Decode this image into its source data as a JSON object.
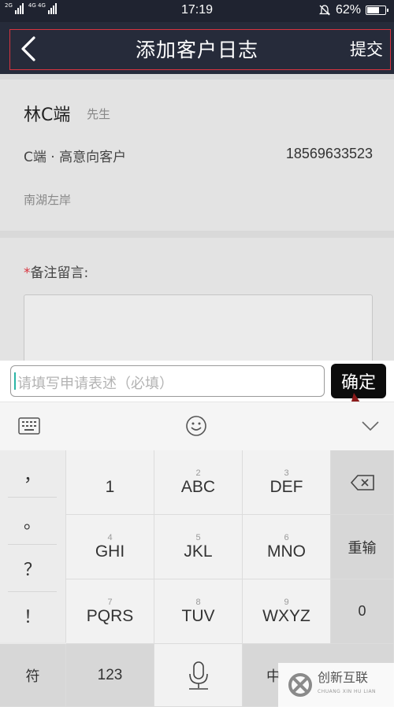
{
  "status_bar": {
    "network_tag_1": "2G",
    "network_tag_2": "4G 4G",
    "time": "17:19",
    "battery": "62%",
    "battery_level": 0.62
  },
  "nav": {
    "title": "添加客户日志",
    "submit": "提交",
    "back_icon": "chevron-left-icon"
  },
  "customer": {
    "name": "林C端",
    "gender": "先生",
    "type": "C端 · 高意向客户",
    "phone": "18569633523",
    "address": "南湖左岸"
  },
  "remark": {
    "required_mark": "*",
    "label": "备注留言:"
  },
  "input_bar": {
    "placeholder": "请填写申请表述（必填）",
    "confirm": "确定"
  },
  "keyboard": {
    "toolbar_icons": [
      "keyboard-icon",
      "emoji-icon",
      "collapse-icon"
    ],
    "punctuation": [
      "，",
      "。",
      "？",
      "！"
    ],
    "rows": [
      [
        {
          "num": "",
          "label": "1"
        },
        {
          "num": "2",
          "label": "ABC"
        },
        {
          "num": "3",
          "label": "DEF"
        }
      ],
      [
        {
          "num": "4",
          "label": "GHI"
        },
        {
          "num": "5",
          "label": "JKL"
        },
        {
          "num": "6",
          "label": "MNO"
        }
      ],
      [
        {
          "num": "7",
          "label": "PQRS"
        },
        {
          "num": "8",
          "label": "TUV"
        },
        {
          "num": "9",
          "label": "WXYZ"
        }
      ]
    ],
    "side_keys": {
      "delete_icon": "backspace-icon",
      "reenter": "重输",
      "zero": "0"
    },
    "bottom": {
      "symbols": "符",
      "numbers": "123",
      "mic_icon": "microphone-icon",
      "chinese": "中"
    }
  },
  "watermark": {
    "text": "创新互联",
    "sub": "CHUANG XIN HU LIAN"
  }
}
